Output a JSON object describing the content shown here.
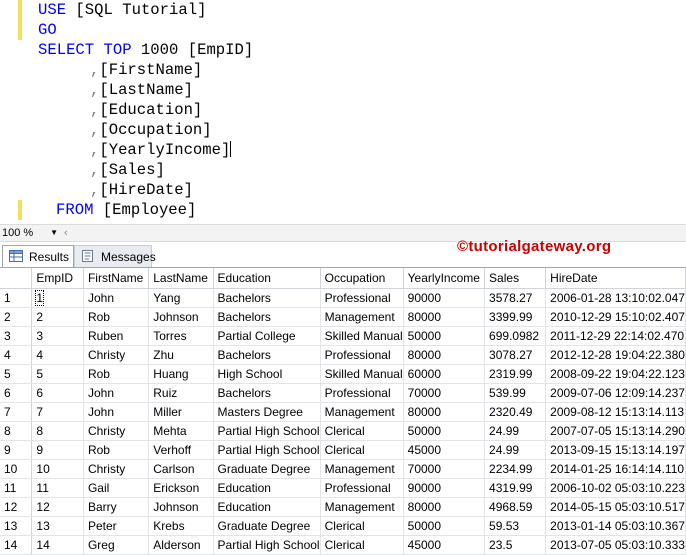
{
  "editor": {
    "lines": [
      {
        "kw": "USE",
        "rest": " [SQL Tutorial]",
        "indent": 0
      },
      {
        "kw": "GO",
        "rest": "",
        "indent": 0
      },
      {
        "kw": "SELECT TOP",
        "rest": " 1000 [EmpID]",
        "indent": 0
      },
      {
        "comma": ",",
        "rest": "[FirstName]",
        "indent": 1
      },
      {
        "comma": ",",
        "rest": "[LastName]",
        "indent": 1
      },
      {
        "comma": ",",
        "rest": "[Education]",
        "indent": 1
      },
      {
        "comma": ",",
        "rest": "[Occupation]",
        "indent": 1
      },
      {
        "comma": ",",
        "rest": "[YearlyIncome]",
        "indent": 1
      },
      {
        "comma": ",",
        "rest": "[Sales]",
        "indent": 1
      },
      {
        "comma": ",",
        "rest": "[HireDate]",
        "indent": 1
      },
      {
        "kw": "FROM",
        "rest": " [Employee]",
        "indent": 2
      }
    ]
  },
  "zoom": {
    "value": "100 %"
  },
  "tabs": {
    "results": "Results",
    "messages": "Messages"
  },
  "watermark": "©tutorialgateway.org",
  "grid": {
    "columns": [
      "EmpID",
      "FirstName",
      "LastName",
      "Education",
      "Occupation",
      "YearlyIncome",
      "Sales",
      "HireDate"
    ],
    "rows": [
      [
        "1",
        "John",
        "Yang",
        "Bachelors",
        "Professional",
        "90000",
        "3578.27",
        "2006-01-28 13:10:02.047"
      ],
      [
        "2",
        "Rob",
        "Johnson",
        "Bachelors",
        "Management",
        "80000",
        "3399.99",
        "2010-12-29 15:10:02.407"
      ],
      [
        "3",
        "Ruben",
        "Torres",
        "Partial College",
        "Skilled Manual",
        "50000",
        "699.0982",
        "2011-12-29 22:14:02.470"
      ],
      [
        "4",
        "Christy",
        "Zhu",
        "Bachelors",
        "Professional",
        "80000",
        "3078.27",
        "2012-12-28 19:04:22.380"
      ],
      [
        "5",
        "Rob",
        "Huang",
        "High School",
        "Skilled Manual",
        "60000",
        "2319.99",
        "2008-09-22 19:04:22.123"
      ],
      [
        "6",
        "John",
        "Ruiz",
        "Bachelors",
        "Professional",
        "70000",
        "539.99",
        "2009-07-06 12:09:14.237"
      ],
      [
        "7",
        "John",
        "Miller",
        "Masters Degree",
        "Management",
        "80000",
        "2320.49",
        "2009-08-12 15:13:14.113"
      ],
      [
        "8",
        "Christy",
        "Mehta",
        "Partial High School",
        "Clerical",
        "50000",
        "24.99",
        "2007-07-05 15:13:14.290"
      ],
      [
        "9",
        "Rob",
        "Verhoff",
        "Partial High School",
        "Clerical",
        "45000",
        "24.99",
        "2013-09-15 15:13:14.197"
      ],
      [
        "10",
        "Christy",
        "Carlson",
        "Graduate Degree",
        "Management",
        "70000",
        "2234.99",
        "2014-01-25 16:14:14.110"
      ],
      [
        "11",
        "Gail",
        "Erickson",
        "Education",
        "Professional",
        "90000",
        "4319.99",
        "2006-10-02 05:03:10.223"
      ],
      [
        "12",
        "Barry",
        "Johnson",
        "Education",
        "Management",
        "80000",
        "4968.59",
        "2014-05-15 05:03:10.517"
      ],
      [
        "13",
        "Peter",
        "Krebs",
        "Graduate Degree",
        "Clerical",
        "50000",
        "59.53",
        "2013-01-14 05:03:10.367"
      ],
      [
        "14",
        "Greg",
        "Alderson",
        "Partial High School",
        "Clerical",
        "45000",
        "23.5",
        "2013-07-05 05:03:10.333"
      ]
    ]
  }
}
